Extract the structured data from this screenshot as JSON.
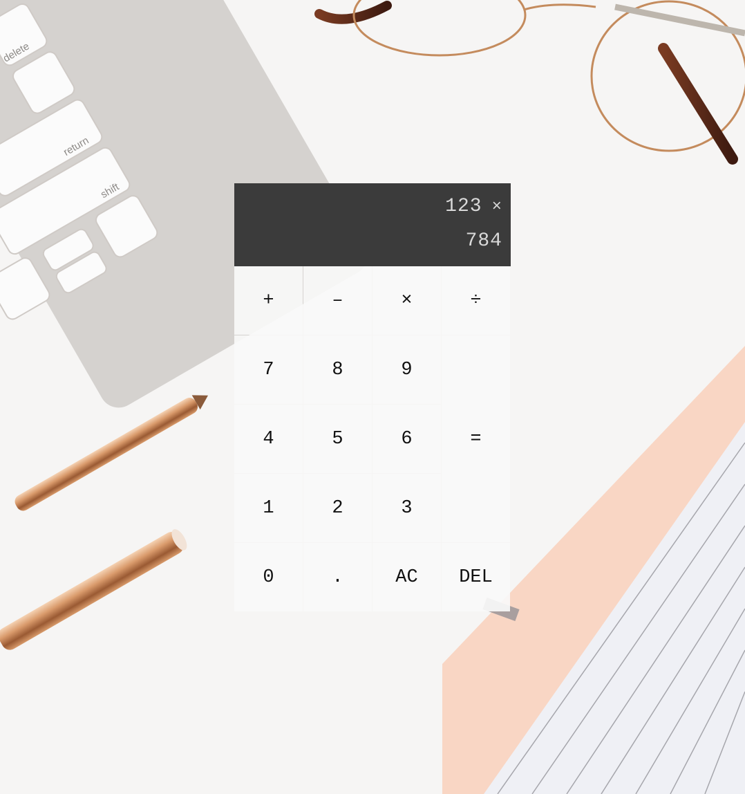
{
  "display": {
    "previous_operand": "123",
    "operator": "×",
    "current_operand": "784"
  },
  "keys": {
    "add": "+",
    "subtract": "–",
    "multiply": "×",
    "divide": "÷",
    "seven": "7",
    "eight": "8",
    "nine": "9",
    "equals": "=",
    "four": "4",
    "five": "5",
    "six": "6",
    "one": "1",
    "two": "2",
    "three": "3",
    "zero": "0",
    "decimal": ".",
    "all_clear": "AC",
    "delete": "DEL"
  },
  "backdrop": {
    "keyboard_labels": [
      "delete",
      "return",
      "shift"
    ],
    "colors": {
      "desk": "#f6f5f4",
      "display": "#3b3b3b",
      "rose_gold": "#c98a5c",
      "notebook_cover": "#f9d6c4"
    },
    "icons": [
      "keyboard-illustration",
      "glasses-illustration",
      "pen-illustration",
      "notebook-illustration"
    ]
  }
}
